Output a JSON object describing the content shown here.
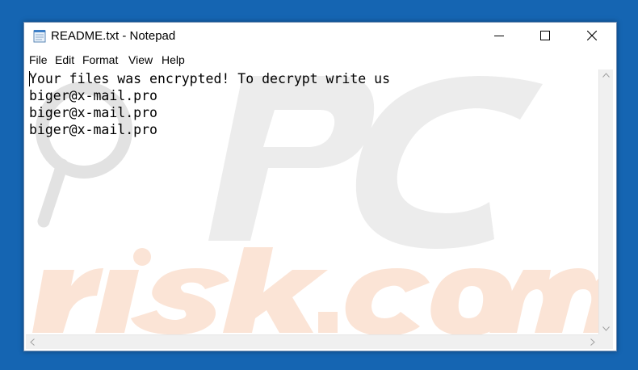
{
  "window": {
    "title": "README.txt - Notepad"
  },
  "menu": {
    "file": "File",
    "edit": "Edit",
    "format": "Format",
    "view": "View",
    "help": "Help"
  },
  "document": {
    "lines": [
      "Your files was encrypted! To decrypt write us",
      "biger@x-mail.pro",
      "biger@x-mail.pro",
      "biger@x-mail.pro"
    ]
  },
  "watermark": {
    "logo_text": "PC risk.com",
    "colors": {
      "gray": "#dcdcdc",
      "orange": "#fbe1d2"
    }
  },
  "icons": {
    "app": "notepad-icon",
    "minimize": "minimize-icon",
    "maximize": "maximize-icon",
    "close": "close-icon"
  },
  "colors": {
    "desktop": "#1565b2",
    "window_bg": "#ffffff",
    "scrollbar": "#f0f0f0"
  }
}
